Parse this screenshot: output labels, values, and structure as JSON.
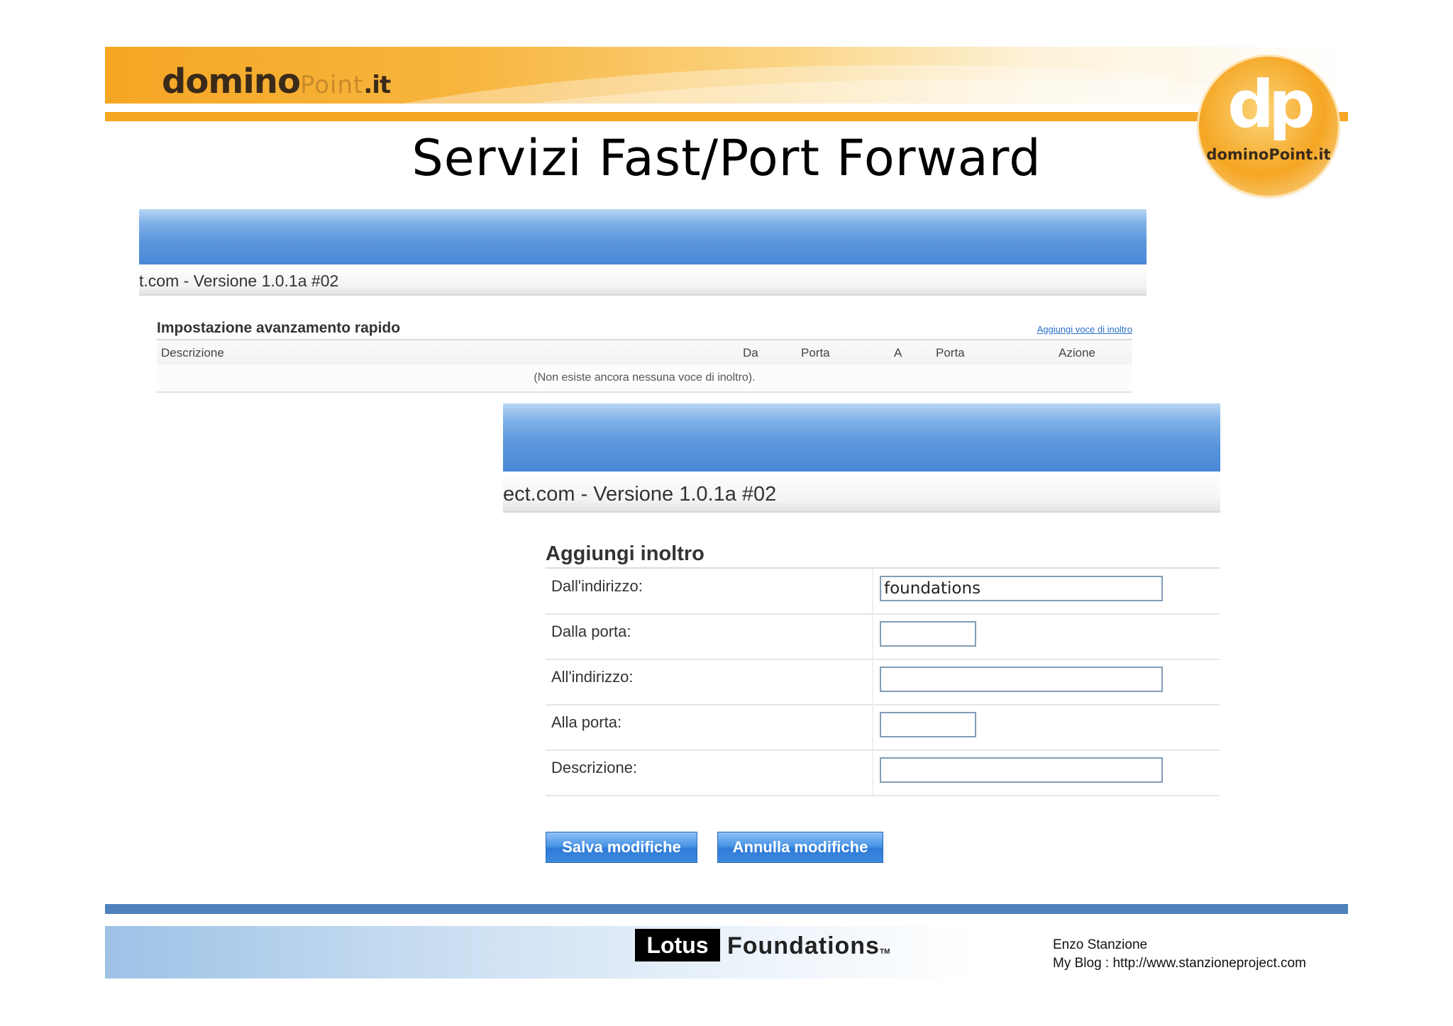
{
  "slide": {
    "brand": {
      "name": "domino",
      "suffix": "Point",
      "tld": ".it"
    },
    "badge": {
      "mark": "dp",
      "text": "dominoPoint.it"
    },
    "title": "Servizi Fast/Port Forward"
  },
  "screenshot1": {
    "version": "t.com - Versione 1.0.1a #02",
    "table": {
      "title": "Impostazione avanzamento rapido",
      "add_link": "Aggiungi voce di inoltro",
      "columns": [
        "Descrizione",
        "Da",
        "Porta",
        "A",
        "Porta",
        "Azione"
      ],
      "empty_message": "(Non esiste ancora nessuna voce di inoltro)."
    }
  },
  "screenshot2": {
    "version": "ect.com - Versione 1.0.1a #02",
    "form": {
      "title": "Aggiungi inoltro",
      "fields": [
        {
          "label": "Dall'indirizzo:",
          "value": "foundations"
        },
        {
          "label": "Dalla porta:",
          "value": ""
        },
        {
          "label": "All'indirizzo:",
          "value": ""
        },
        {
          "label": "Alla porta:",
          "value": ""
        },
        {
          "label": "Descrizione:",
          "value": ""
        }
      ],
      "save_label": "Salva modifiche",
      "cancel_label": "Annulla modifiche"
    }
  },
  "footer": {
    "lotus": "Lotus",
    "foundations": "Foundations",
    "tm": "TM",
    "author": "Enzo Stanzione",
    "blog": "My Blog : http://www.stanzioneproject.com"
  },
  "colors": {
    "orange": "#f5a623",
    "blue_rule": "#4f81bd",
    "button_blue": "#3f8ae0",
    "link_blue": "#2a6fc9"
  }
}
